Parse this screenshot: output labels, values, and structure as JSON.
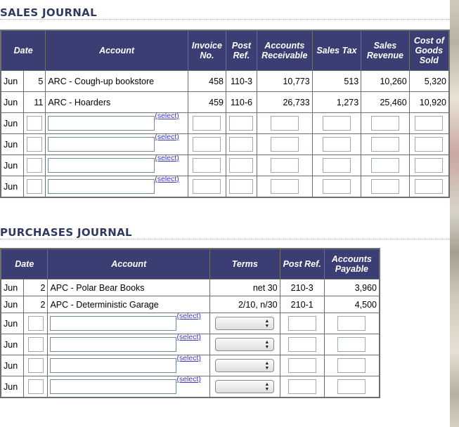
{
  "sales_journal": {
    "title": "SALES JOURNAL",
    "headers": {
      "date": "Date",
      "account": "Account",
      "invoice_no": "Invoice No.",
      "post_ref": "Post Ref.",
      "accounts_receivable": "Accounts Receivable",
      "sales_tax": "Sales Tax",
      "sales_revenue": "Sales Revenue",
      "cogs": "Cost of Goods Sold"
    },
    "rows": [
      {
        "month": "Jun",
        "day": "5",
        "account": "ARC - Cough-up bookstore",
        "invoice": "458",
        "post_ref": "110-3",
        "ar": "10,773",
        "tax": "513",
        "revenue": "10,260",
        "cogs": "5,320"
      },
      {
        "month": "Jun",
        "day": "11",
        "account": "ARC - Hoarders",
        "invoice": "459",
        "post_ref": "110-6",
        "ar": "26,733",
        "tax": "1,273",
        "revenue": "25,460",
        "cogs": "10,920"
      }
    ],
    "empty_rows": [
      {
        "month": "Jun",
        "select": "(select)"
      },
      {
        "month": "Jun",
        "select": "(select)"
      },
      {
        "month": "Jun",
        "select": "(select)"
      },
      {
        "month": "Jun",
        "select": "(select)"
      }
    ]
  },
  "purchases_journal": {
    "title": "PURCHASES JOURNAL",
    "headers": {
      "date": "Date",
      "account": "Account",
      "terms": "Terms",
      "post_ref": "Post Ref.",
      "accounts_payable": "Accounts Payable"
    },
    "rows": [
      {
        "month": "Jun",
        "day": "2",
        "account": "APC - Polar Bear Books",
        "terms": "net 30",
        "post_ref": "210-3",
        "ap": "3,960"
      },
      {
        "month": "Jun",
        "day": "2",
        "account": "APC - Deterministic Garage",
        "terms": "2/10, n/30",
        "post_ref": "210-1",
        "ap": "4,500"
      }
    ],
    "empty_rows": [
      {
        "month": "Jun",
        "select": "(select)"
      },
      {
        "month": "Jun",
        "select": "(select)"
      },
      {
        "month": "Jun",
        "select": "(select)"
      },
      {
        "month": "Jun",
        "select": "(select)"
      }
    ]
  },
  "colors": {
    "header_bg": "#3a3e73",
    "title": "#2f3a5e",
    "link": "#3a37c9"
  }
}
